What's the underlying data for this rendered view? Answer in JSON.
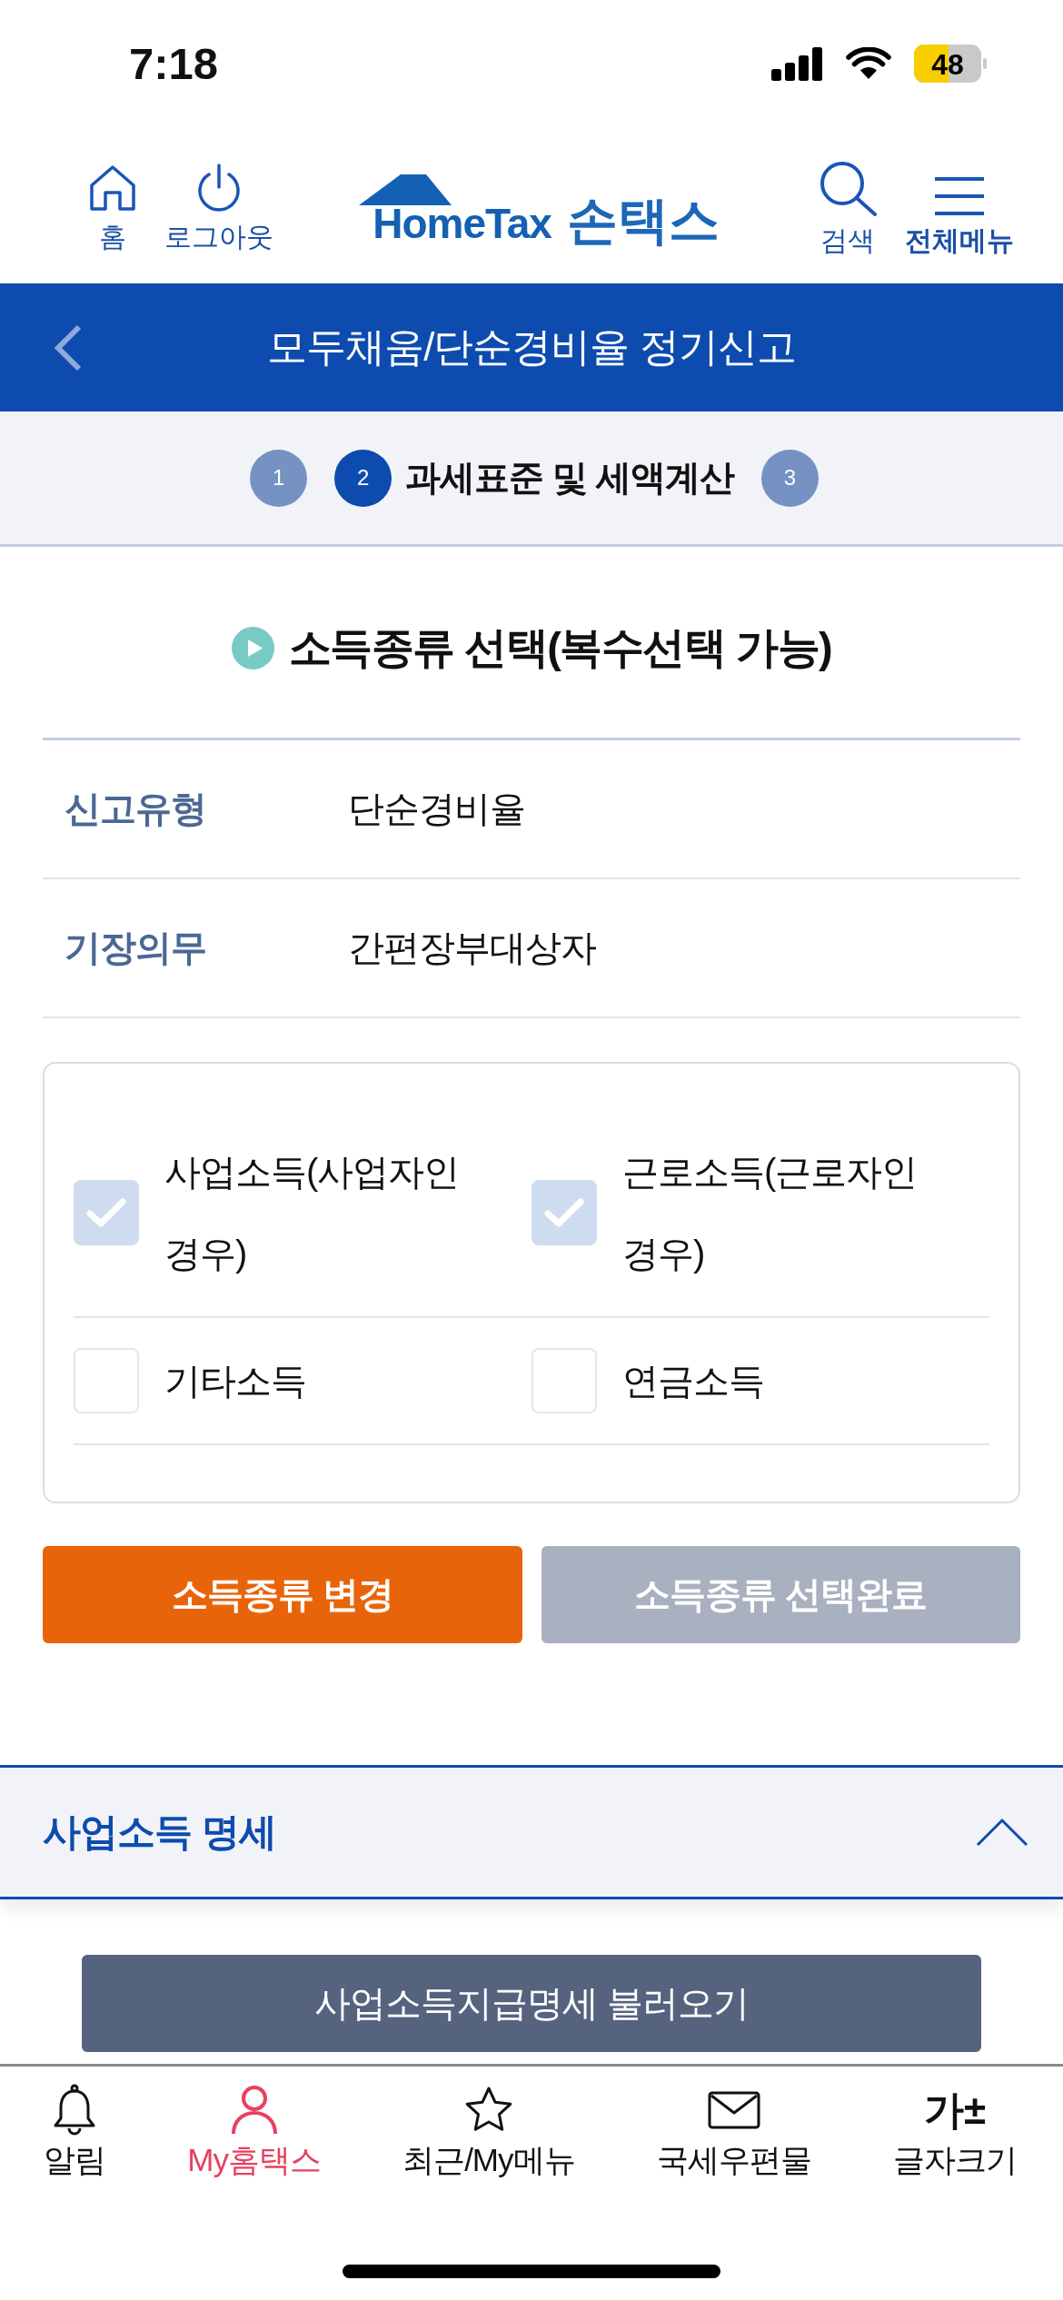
{
  "status_bar": {
    "time": "7:18",
    "battery": "48"
  },
  "header": {
    "left": [
      {
        "kind": "home",
        "label": "홈"
      },
      {
        "kind": "power",
        "label": "로그아웃"
      }
    ],
    "logo": {
      "wordmark": "HomeTax",
      "name": "손택스"
    },
    "right": [
      {
        "kind": "search",
        "label": "검색"
      },
      {
        "kind": "menu",
        "label": "전체메뉴"
      }
    ]
  },
  "title_bar": {
    "title": "모두채움/단순경비율 정기신고"
  },
  "steps": [
    {
      "number": "1",
      "selected": false
    },
    {
      "number": "2",
      "selected": true,
      "label": "과세표준 및 세액계산"
    },
    {
      "number": "3",
      "selected": false
    }
  ],
  "section_title": "소득종류 선택(복수선택 가능)",
  "info_rows": [
    {
      "label": "신고유형",
      "value": "단순경비율"
    },
    {
      "label": "기장의무",
      "value": "간편장부대상자"
    }
  ],
  "income_types": [
    {
      "label": "사업소득(사업자인 경우)",
      "checked": true
    },
    {
      "label": "근로소득(근로자인 경우)",
      "checked": true
    },
    {
      "label": "기타소득",
      "checked": false
    },
    {
      "label": "연금소득",
      "checked": false
    }
  ],
  "buttons": [
    {
      "label": "소득종류 변경",
      "disabled": false
    },
    {
      "label": "소득종류 선택완료",
      "disabled": true
    }
  ],
  "accordion": {
    "title": "사업소득 명세",
    "expanded": true,
    "button": "사업소득지급명세 불러오기"
  },
  "tab_bar": [
    {
      "kind": "bell",
      "label": "알림",
      "selected": false
    },
    {
      "kind": "person",
      "label": "My홈택스",
      "selected": true
    },
    {
      "kind": "star",
      "label": "최근/My메뉴",
      "selected": false
    },
    {
      "kind": "mail",
      "label": "국세우편물",
      "selected": false
    },
    {
      "kind": "glyph",
      "glyph": "가±",
      "label": "글자크기",
      "selected": false
    }
  ]
}
